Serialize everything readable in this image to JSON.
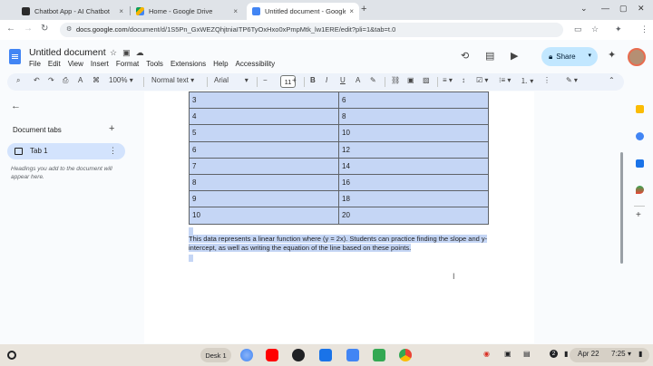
{
  "browser": {
    "tabs": [
      {
        "title": "Chatbot App - AI Chatbot",
        "close": "×"
      },
      {
        "title": "Home - Google Drive",
        "close": "×"
      },
      {
        "title": "Untitled document - Google Do",
        "close": "×"
      }
    ],
    "new_tab": "+",
    "url_site": "docs.google.com",
    "url_path": "/document/d/1S5Pn_GxWEZQhjtniaITP6TyOxHxo0xPmpMtk_lw1ERE/edit?pli=1&tab=t.0"
  },
  "docs": {
    "title": "Untitled document",
    "menu": [
      "File",
      "Edit",
      "View",
      "Insert",
      "Format",
      "Tools",
      "Extensions",
      "Help",
      "Accessibility"
    ],
    "share_label": "Share",
    "toolbar": {
      "zoom": "100%",
      "style": "Normal text",
      "font": "Arial",
      "font_size": "11"
    },
    "left_panel": {
      "heading": "Document tabs",
      "tab_label": "Tab 1",
      "hint": "Headings you add to the document will appear here."
    },
    "table": {
      "rows": [
        [
          "3",
          "6"
        ],
        [
          "4",
          "8"
        ],
        [
          "5",
          "10"
        ],
        [
          "6",
          "12"
        ],
        [
          "7",
          "14"
        ],
        [
          "8",
          "16"
        ],
        [
          "9",
          "18"
        ],
        [
          "10",
          "20"
        ]
      ]
    },
    "paragraph": "This data represents a linear function where (y = 2x). Students can practice finding the slope and y-intercept, as well as writing the equation of the line based on these points."
  },
  "taskbar": {
    "desk_label": "Desk 1",
    "notification_count": "2",
    "date": "Apr 22",
    "time": "7:25"
  },
  "colors": {
    "selection": "#c5d6f5",
    "share_bg": "#c2e7ff",
    "tab1_bg": "#d3e3fd",
    "toolbar_bg": "#edf2fa"
  }
}
